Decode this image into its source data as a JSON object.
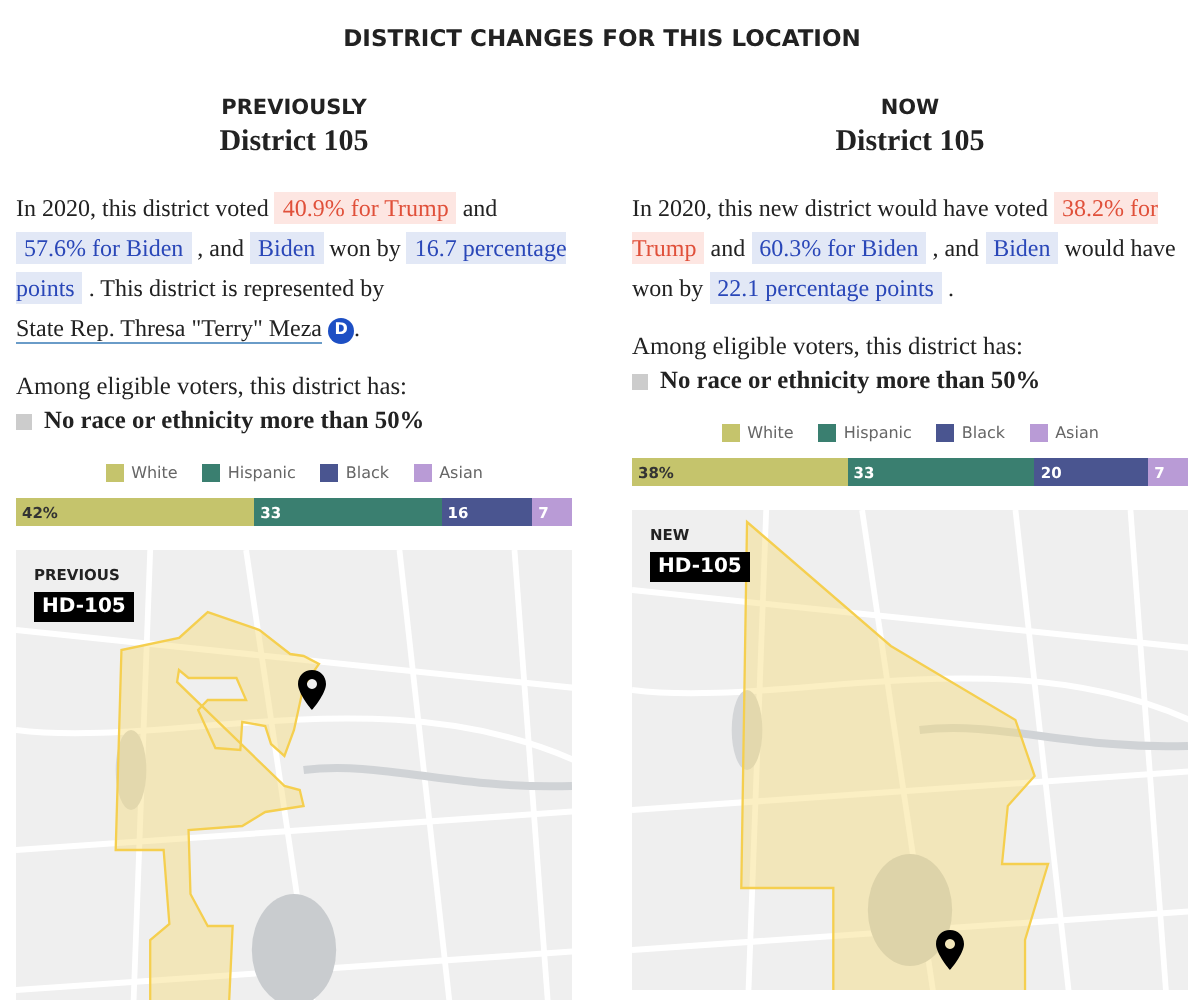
{
  "title": "DISTRICT CHANGES FOR THIS LOCATION",
  "columns": [
    {
      "eyebrow": "PREVIOUSLY",
      "district": "District 105",
      "sentence": [
        {
          "kind": "plain",
          "text": "In 2020, this district voted"
        },
        {
          "kind": "rep",
          "text": "40.9% for Trump"
        },
        {
          "kind": "plain",
          "text": "and"
        },
        {
          "kind": "dem",
          "text": "57.6% for Biden"
        },
        {
          "kind": "plain",
          "text": ", and"
        },
        {
          "kind": "dem",
          "text": "Biden"
        },
        {
          "kind": "plain",
          "text": "won by"
        },
        {
          "kind": "dem",
          "text": "16.7 percentage points"
        },
        {
          "kind": "plain",
          "text": ". This district is represented by"
        },
        {
          "kind": "link",
          "text": "State Rep. Thresa \"Terry\" Meza"
        },
        {
          "kind": "party",
          "text": "D"
        },
        {
          "kind": "plain",
          "text": "."
        }
      ],
      "among": "Among eligible voters, this district has:",
      "majority": "No race or ethnicity more than 50%",
      "legend": [
        {
          "label": "White",
          "color": "#c5c46c"
        },
        {
          "label": "Hispanic",
          "color": "#3a7f70"
        },
        {
          "label": "Black",
          "color": "#4a5590"
        },
        {
          "label": "Asian",
          "color": "#b99bd6"
        }
      ],
      "segments": [
        {
          "label": "42%"
        },
        {
          "label": "33"
        },
        {
          "label": "16"
        },
        {
          "label": "7"
        }
      ],
      "map": {
        "kind": "picture",
        "tag": "PREVIOUS",
        "badge": "HD-105"
      }
    },
    {
      "eyebrow": "NOW",
      "district": "District 105",
      "sentence": [
        {
          "kind": "plain",
          "text": "In 2020, this new district would have voted"
        },
        {
          "kind": "rep",
          "text": "38.2% for Trump"
        },
        {
          "kind": "plain",
          "text": "and"
        },
        {
          "kind": "dem",
          "text": "60.3% for Biden"
        },
        {
          "kind": "plain",
          "text": ", and"
        },
        {
          "kind": "dem",
          "text": "Biden"
        },
        {
          "kind": "plain",
          "text": "would have won by"
        },
        {
          "kind": "dem",
          "text": "22.1 percentage points"
        },
        {
          "kind": "plain",
          "text": "."
        }
      ],
      "among": "Among eligible voters, this district has:",
      "majority": "No race or ethnicity more than 50%",
      "legend": [
        {
          "label": "White",
          "color": "#c5c46c"
        },
        {
          "label": "Hispanic",
          "color": "#3a7f70"
        },
        {
          "label": "Black",
          "color": "#4a5590"
        },
        {
          "label": "Asian",
          "color": "#b99bd6"
        }
      ],
      "segments": [
        {
          "label": "38%"
        },
        {
          "label": "33"
        },
        {
          "label": "20"
        },
        {
          "label": "7"
        }
      ],
      "map": {
        "kind": "picture",
        "tag": "NEW",
        "badge": "HD-105"
      }
    }
  ]
}
